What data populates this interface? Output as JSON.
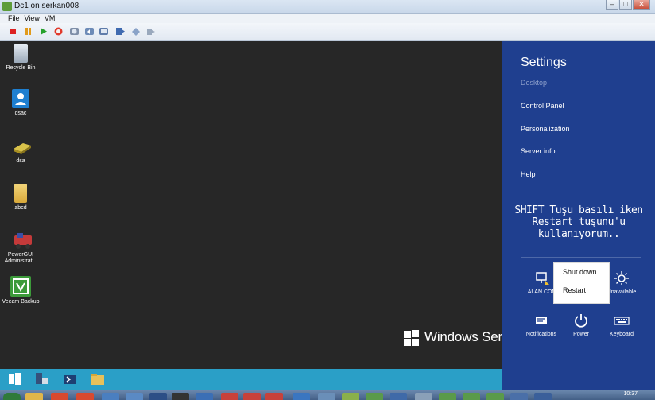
{
  "window": {
    "title": "Dc1 on serkan008"
  },
  "window_controls": {
    "minimize": "–",
    "maximize": "□",
    "close": "✕"
  },
  "menu": {
    "file": "File",
    "view": "View",
    "vm": "VM"
  },
  "desktop_icons": [
    {
      "label": "Recycle Bin",
      "icon": "recycle-bin-icon"
    },
    {
      "label": "dsac",
      "icon": "user-admin-icon"
    },
    {
      "label": "dsa",
      "icon": "directory-icon"
    },
    {
      "label": "abcd",
      "icon": "folder-icon"
    },
    {
      "label": "PowerGUI Administrat...",
      "icon": "powergui-icon"
    },
    {
      "label": "Veeam Backup ...",
      "icon": "veeam-icon"
    }
  ],
  "watermark": {
    "text": "Windows Serv"
  },
  "settings": {
    "title": "Settings",
    "items": [
      "Desktop",
      "Control Panel",
      "Personalization",
      "Server info",
      "Help"
    ]
  },
  "annotation": {
    "text": "SHIFT Tuşu basılı iken Restart tuşunu'u kullanıyorum.."
  },
  "tiles": {
    "network": "ALAN.COM",
    "volume": "",
    "brightness": "Unavailable",
    "notifications": "Notifications",
    "power": "Power",
    "keyboard": "Keyboard"
  },
  "power_menu": {
    "shutdown": "Shut down",
    "restart": "Restart"
  },
  "host_clock": "10:37",
  "colors": {
    "charms_bg": "#1f3f8f",
    "vm_taskbar": "#2a9fc7",
    "desktop_bg": "#272727"
  }
}
